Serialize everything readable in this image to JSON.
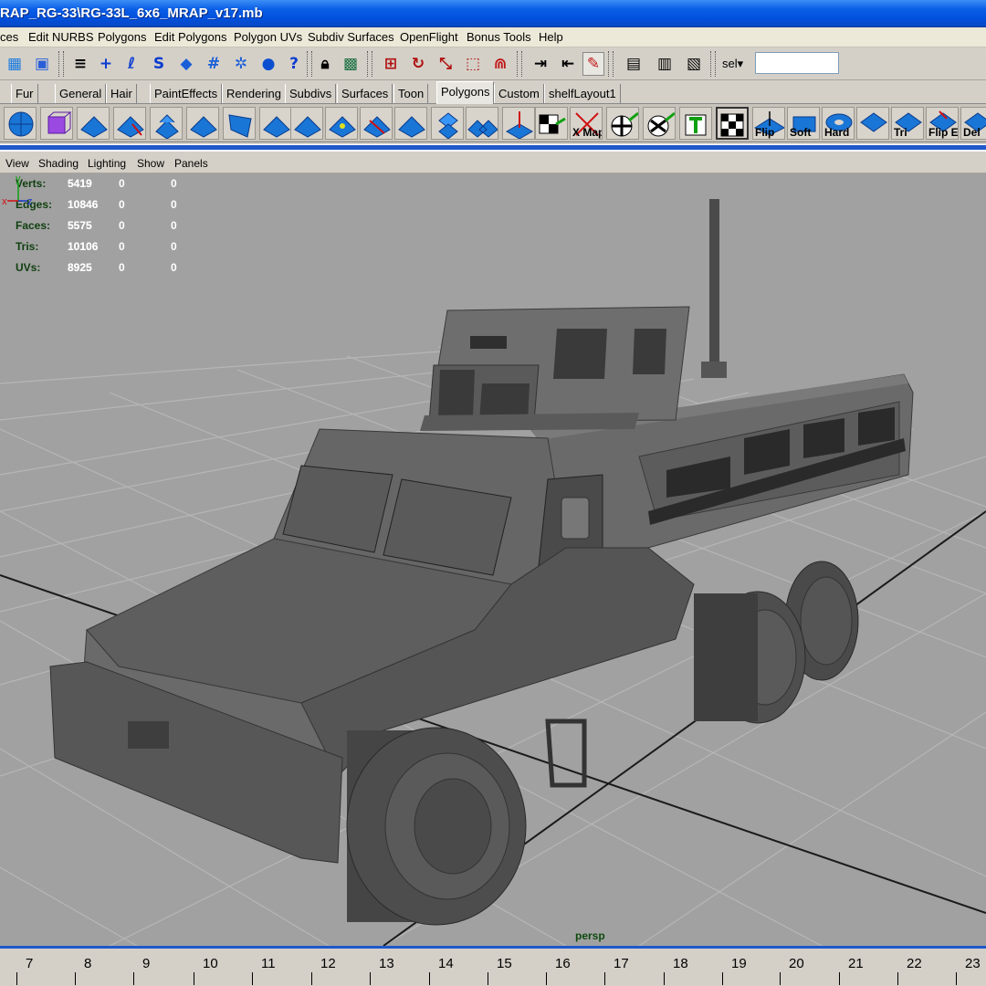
{
  "window": {
    "title": "RAP_RG-33\\RG-33L_6x6_MRAP_v17.mb"
  },
  "menu": [
    "ces",
    "Edit NURBS",
    "Polygons",
    "Edit Polygons",
    "Polygon UVs",
    "Subdiv Surfaces",
    "OpenFlight",
    "Bonus Tools",
    "Help"
  ],
  "statusline": {
    "sel_label": "sel▾",
    "sel_value": "",
    "icons": [
      "select-hierarchy-icon",
      "select-object-icon",
      "snap-icon",
      "add-icon",
      "snap-curve-icon",
      "snap-point-icon",
      "snap-plane-icon",
      "snap-grid-icon",
      "snap-surface-icon",
      "sphere-icon",
      "help-icon",
      "lock-icon",
      "history-icon",
      "select-by-component-icon",
      "snap-to-curve-icon",
      "magnet-icon",
      "input-ops-icon",
      "output-ops-icon",
      "construction-history-icon",
      "render-icon",
      "ipr-icon",
      "render-globals-icon"
    ]
  },
  "shelf_tabs": [
    "Fur",
    "General",
    "Hair",
    "PaintEffects",
    "Rendering",
    "Subdivs",
    "Surfaces",
    "Toon",
    "Polygons",
    "Custom",
    "shelfLayout1"
  ],
  "shelf_active": "Polygons",
  "shelf_labels": {
    "map": "X Map",
    "flip": "Flip",
    "soft": "Soft",
    "hard": "Hard",
    "tri": "Tri",
    "flip_e": "Flip E",
    "del": "Del"
  },
  "panel_menu": [
    "View",
    "Shading",
    "Lighting",
    "Show",
    "Panels"
  ],
  "hud": [
    {
      "label": "Verts:",
      "values": [
        "5419",
        "0",
        "0"
      ]
    },
    {
      "label": "Edges:",
      "values": [
        "10846",
        "0",
        "0"
      ]
    },
    {
      "label": "Faces:",
      "values": [
        "5575",
        "0",
        "0"
      ]
    },
    {
      "label": "Tris:",
      "values": [
        "10106",
        "0",
        "0"
      ]
    },
    {
      "label": "UVs:",
      "values": [
        "8925",
        "0",
        "0"
      ]
    }
  ],
  "camera": "persp",
  "axis": {
    "x": "x",
    "y": "y",
    "z": "z"
  },
  "timeline_ticks": [
    "7",
    "8",
    "9",
    "10",
    "11",
    "12",
    "13",
    "14",
    "15",
    "16",
    "17",
    "18",
    "19",
    "20",
    "21",
    "22",
    "23"
  ],
  "colors": {
    "title_blue": "#0050dc",
    "viewport_bg": "#a1a1a1",
    "grid": "#b8b8b8",
    "model": "#5c5c5c",
    "hud_label": "#0f3f0f"
  }
}
